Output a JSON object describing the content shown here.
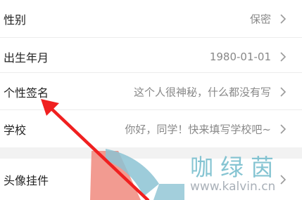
{
  "profile": {
    "rows": [
      {
        "label": "性别",
        "value": "保密"
      },
      {
        "label": "出生年月",
        "value": "1980-01-01"
      },
      {
        "label": "个性签名",
        "value": "这个人很神秘，什么都没有写"
      },
      {
        "label": "学校",
        "value": "你好，同学！快来填写学校吧~"
      }
    ],
    "pendant_row": {
      "label": "头像挂件"
    }
  },
  "icons": {
    "row_arrow": "chevron-right-icon",
    "annotation": "red-arrow-annotation"
  },
  "watermark": {
    "chinese": "咖绿茵",
    "url": "www.kalvin.cn"
  },
  "colors": {
    "background": "#f2f2f2",
    "row": "#ffffff",
    "label": "#222222",
    "value": "#888888",
    "annotation": "#f02020",
    "watermark": "#78becd"
  }
}
